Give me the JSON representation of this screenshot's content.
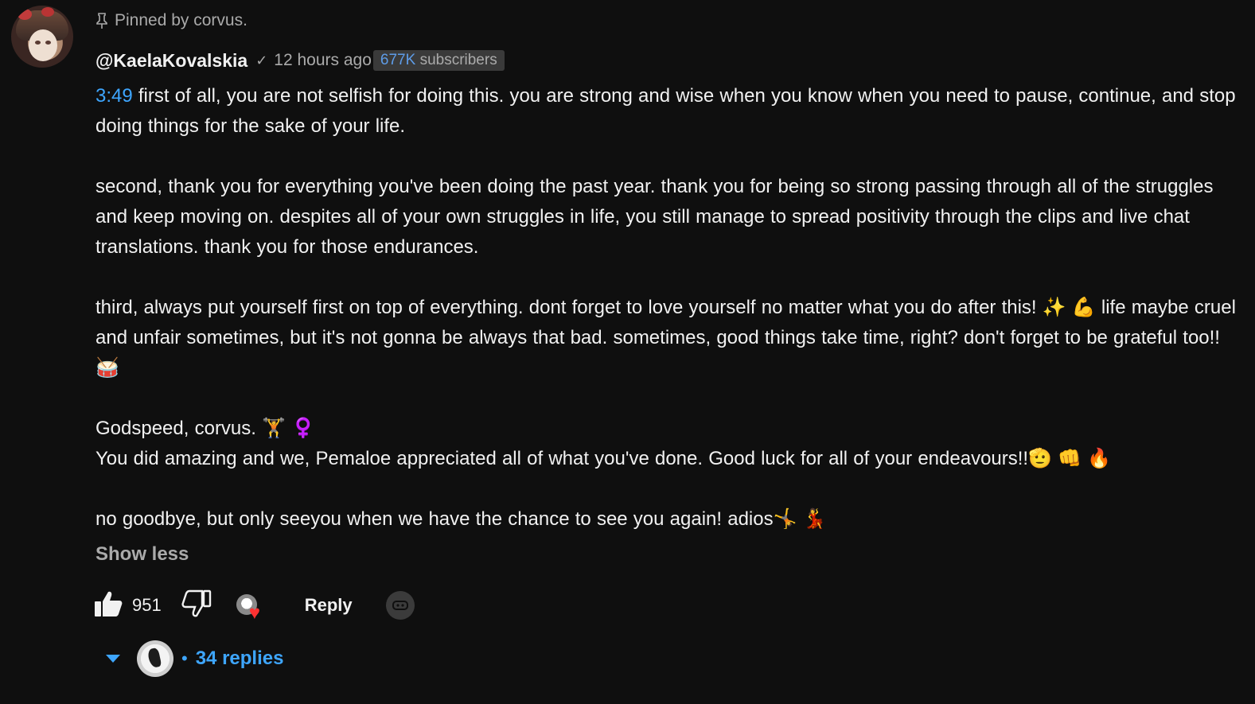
{
  "comment": {
    "pinned_text": "Pinned by corvus.",
    "author": "@KaelaKovalskia",
    "verified_mark": "✓",
    "timestamp": "12 hours ago",
    "subscriber_count": "677K",
    "subscriber_label": "subscribers",
    "video_timestamp": "3:49",
    "paragraphs": {
      "p1": "first of all, you are not selfish for doing this. you are strong and wise when you know when you need to pause, continue, and stop doing things for the sake of your life.",
      "p2": "second, thank you for everything you've been doing the past year. thank you for being so strong passing through all of the struggles and keep moving on. despites all of your own struggles in life, you still manage to spread positivity through the clips and live chat translations. thank you for those endurances.",
      "p3": "third, always put yourself first on top of everything. dont forget to love yourself no matter what you do after this! ✨ 💪 life maybe cruel and unfair sometimes, but it's not gonna be always that bad. sometimes, good things take time, right? don't forget to be grateful too!! 🥁",
      "p4": "Godspeed, corvus. 🏋 ♀️",
      "p5": "You did amazing and we, Pemaloe appreciated all of what you've done. Good luck for all of your endeavours!!🫡 👊 🔥",
      "p6": "no goodbye, but only seeyou when we have the chance to see you again! adios🤸 💃"
    },
    "show_less_label": "Show less",
    "like_count": "951",
    "reply_label": "Reply",
    "replies_separator": "•",
    "replies_label": "34 replies"
  },
  "colors": {
    "background": "#0f0f0f",
    "text": "#f1f1f1",
    "muted": "#aaaaaa",
    "link": "#3ea6ff",
    "heart": "#ff3232"
  },
  "icons": [
    "pin-icon",
    "verified-check-icon",
    "thumbs-up-icon",
    "thumbs-down-icon",
    "creator-heart-icon",
    "more-icon",
    "chevron-down-icon"
  ]
}
